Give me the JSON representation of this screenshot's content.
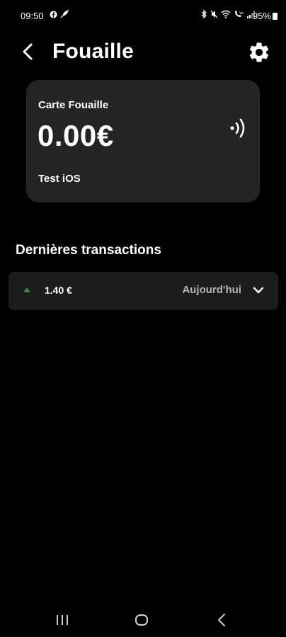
{
  "status_bar": {
    "time": "09:50",
    "left_icons": [
      "facebook-icon",
      "feather-icon"
    ],
    "right_icons": [
      "bluetooth-icon",
      "mute-icon",
      "wifi-icon",
      "call-icon",
      "signal-icon"
    ],
    "battery": "95%"
  },
  "header": {
    "title": "Fouaille",
    "back_icon": "chevron-left-icon",
    "settings_icon": "gear-icon"
  },
  "card": {
    "name": "Carte Fouaille",
    "balance": "0.00€",
    "holder": "Test iOS",
    "contactless_icon": "contactless-icon",
    "background": "#242424"
  },
  "transactions": {
    "title": "Dernières transactions",
    "items": [
      {
        "direction_icon": "arrow-up-icon",
        "direction_color": "#3a8a34",
        "amount": "1.40 €",
        "date": "Aujourd'hui"
      }
    ]
  },
  "nav_bar": {
    "buttons": [
      "recents-icon",
      "home-icon",
      "back-icon"
    ]
  },
  "colors": {
    "background": "#000000",
    "text": "#ffffff",
    "secondary_text": "#b5b5b5",
    "row_background": "#1c1c1c"
  }
}
